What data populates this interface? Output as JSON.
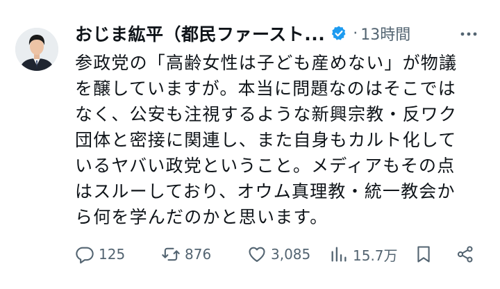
{
  "post": {
    "author": "おじま紘平（都民ファースト...",
    "separator": "·",
    "time_ago": "13時間",
    "text_lines": [
      "参政党の「高齢女性は子ども産めない」が物議",
      "を醸していますが。本当に問題なのはそこでは",
      "なく、公安も注視するような新興宗教・反ワク",
      "団体と密接に関連し、また自身もカルト化して",
      "いるヤバい政党ということ。メディアもその点",
      "はスルーしており、オウム真理教・統一教会か",
      "ら何を学んだのかと思います。"
    ]
  },
  "actions": {
    "replies": "125",
    "reposts": "876",
    "likes": "3,085",
    "views": "15.7万"
  },
  "icons": {
    "verified": "verified-badge-icon",
    "more": "more-options-icon",
    "reply": "reply-icon",
    "repost": "repost-icon",
    "like": "like-icon",
    "views": "views-icon",
    "bookmark": "bookmark-icon",
    "share": "share-icon"
  },
  "colors": {
    "text": "#0f1419",
    "muted": "#536471",
    "verified": "#1d9bf0",
    "background": "#ffffff"
  }
}
